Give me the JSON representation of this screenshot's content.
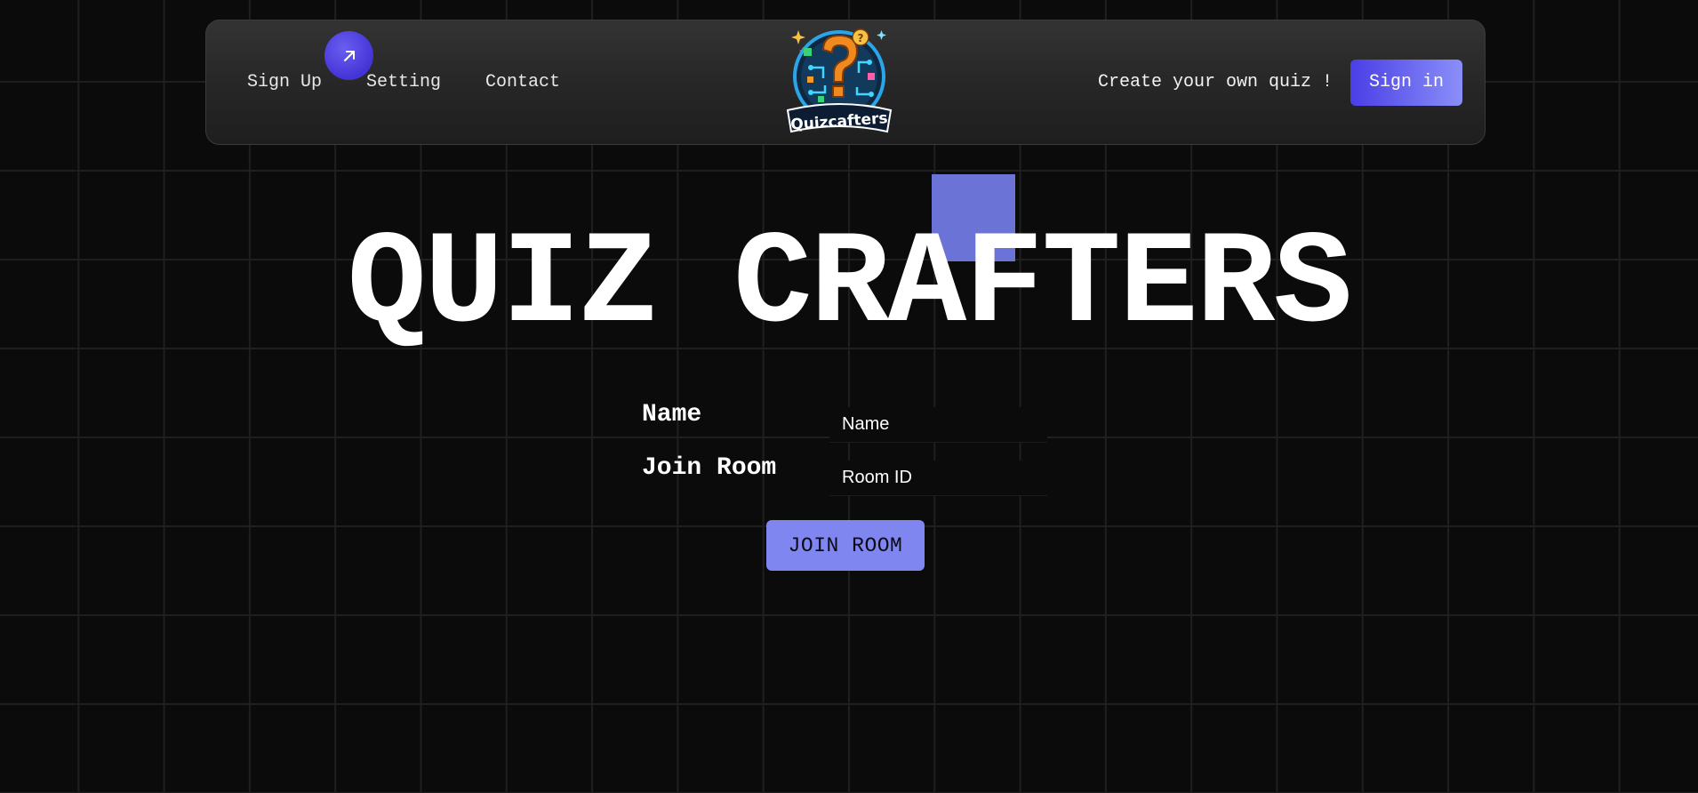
{
  "nav": {
    "links": [
      "Sign Up",
      "Setting",
      "Contact"
    ],
    "cursor_icon": "arrow-up-right-icon",
    "logo_text": "Quizcafters",
    "cta_text": "Create your own quiz !",
    "signin_label": "Sign in"
  },
  "hero": {
    "title": "QUIZ CRAFTERS"
  },
  "form": {
    "name_label": "Name",
    "name_placeholder": "Name",
    "room_label": "Join Room",
    "room_placeholder": "Room ID",
    "join_label": "JOIN ROOM"
  },
  "colors": {
    "background": "#0b0b0b",
    "accent": "#7f86f0",
    "accent_dark": "#4a3ee6",
    "square": "#6b74d6"
  }
}
